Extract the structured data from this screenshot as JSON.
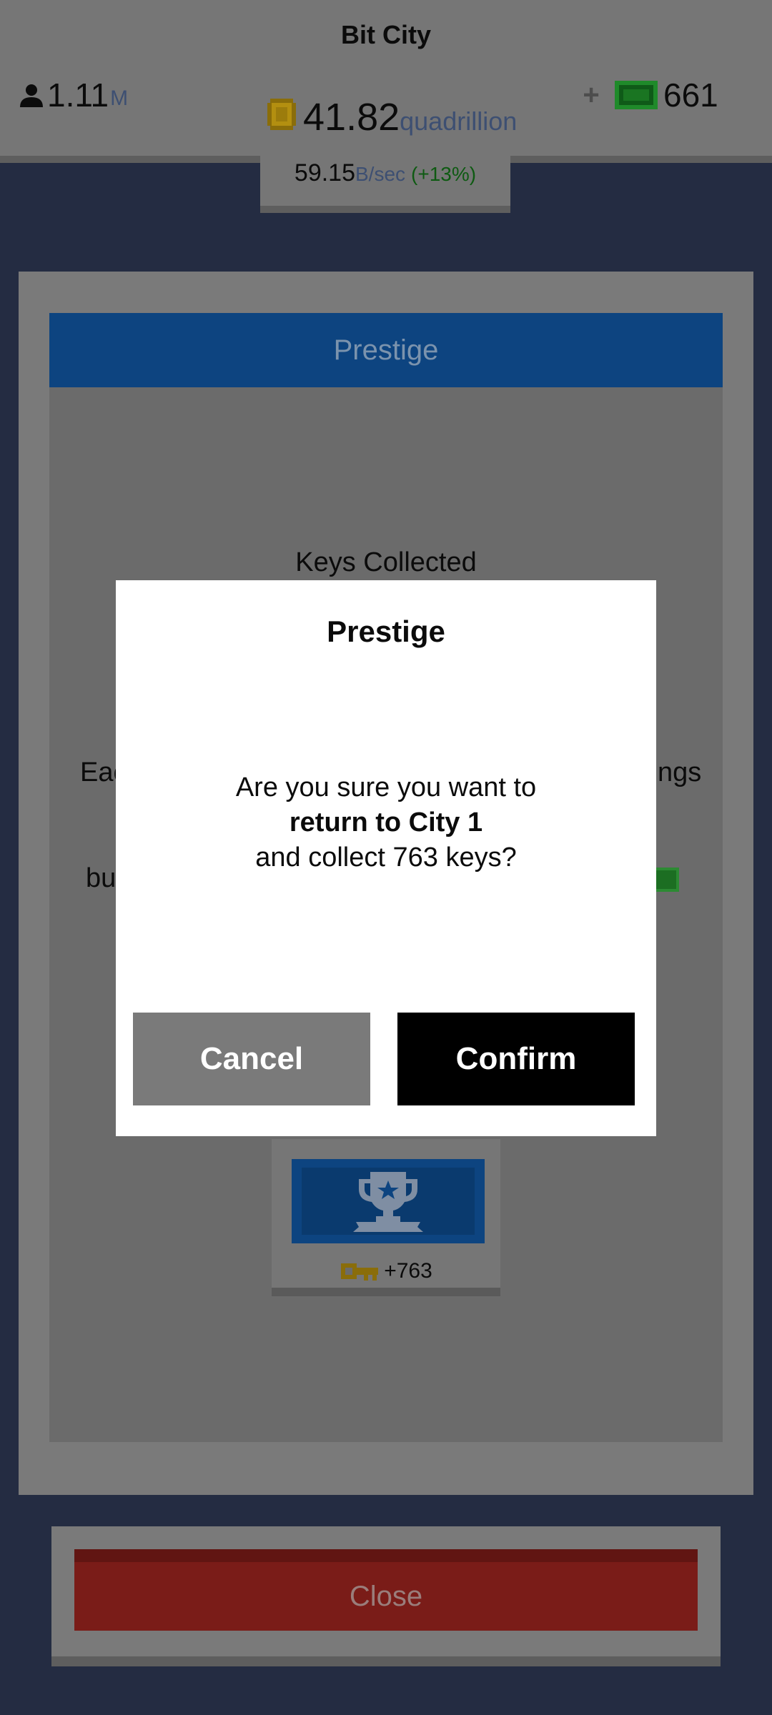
{
  "hud": {
    "city_name": "Bit City",
    "population_value": "1.11",
    "population_unit": "M",
    "money_value": "41.82",
    "money_unit": "quadrillion",
    "rate_value": "59.15",
    "rate_unit": "B/sec",
    "rate_bonus": "(+13%)",
    "add_label": "+",
    "cash_value": "661"
  },
  "prestige_panel": {
    "title": "Prestige",
    "keys_collected_label": "Keys Collected",
    "desc_line1_left": "Eac",
    "desc_line1_right": "ngs",
    "desc_line2_left": "bu",
    "reward_keys": "+763"
  },
  "dialog": {
    "title": "Prestige",
    "message_line1": "Are you sure you want to",
    "message_line2": "return to City 1",
    "message_line3": "and collect 763 keys?",
    "cancel_label": "Cancel",
    "confirm_label": "Confirm"
  },
  "footer": {
    "close_label": "Close"
  },
  "colors": {
    "background": "#242c42",
    "hud": "#767676",
    "panel_header": "#0d4480",
    "close_button": "#7a1c18",
    "confirm_button": "#000000",
    "cancel_button": "#7a7a7a",
    "rate_bonus": "#0e5a12"
  }
}
